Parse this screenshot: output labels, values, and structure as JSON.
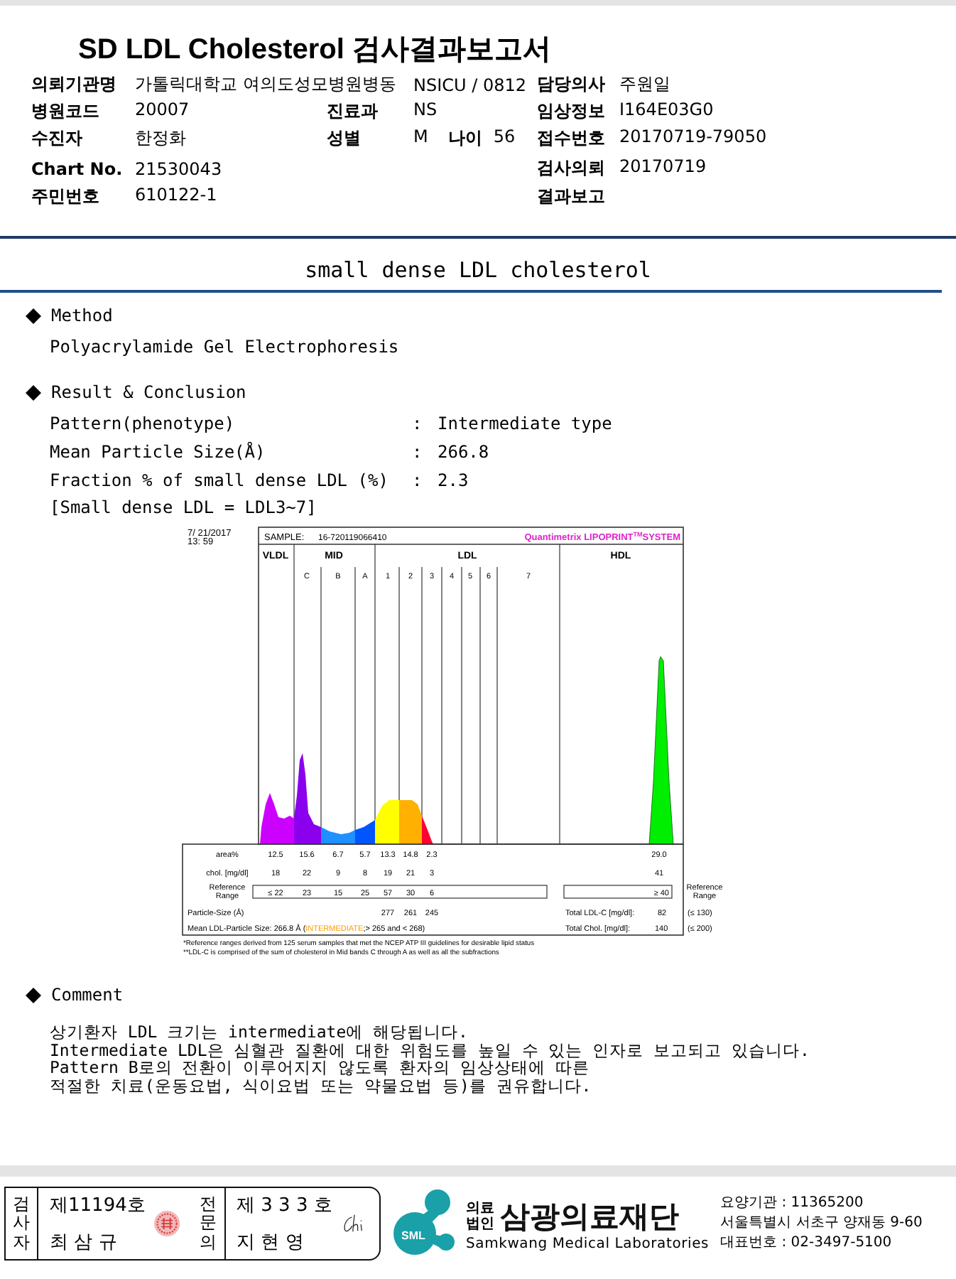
{
  "title": "SD LDL Cholesterol 검사결과보고서",
  "info_rows": [
    {
      "left": {
        "label": "의뢰기관명",
        "value": "가톨릭대학교 여의도성모병원병동"
      },
      "middle": [
        {
          "value": "NSICU / 0812"
        }
      ],
      "right": {
        "label": "담당의사",
        "value": "주원일"
      }
    },
    {
      "left": {
        "label": "병원코드",
        "value": "20007"
      },
      "middle": [
        {
          "label": "진료과",
          "value": "NS"
        }
      ],
      "right": {
        "label": "임상정보",
        "value": "I164E03G0"
      }
    },
    {
      "left": {
        "label": "수진자",
        "value": "한정화"
      },
      "middle": [
        {
          "label": "성별",
          "value": "M"
        },
        {
          "label": "나이",
          "value": "56"
        }
      ],
      "right": {
        "label": "접수번호",
        "value": "20170719-79050"
      }
    },
    {
      "left": {
        "label": "Chart No.",
        "value": "21530043"
      },
      "middle": [],
      "right": {
        "label": "검사의뢰",
        "value": "20170719"
      }
    },
    {
      "left": {
        "label": "주민번호",
        "value": "610122-1"
      },
      "middle": [],
      "right": {
        "label": "결과보고"
      }
    }
  ],
  "section_title": "small dense LDL cholesterol",
  "method": {
    "heading": "Method",
    "text": "Polyacrylamide Gel Electrophoresis"
  },
  "result": {
    "heading": "Result & Conclusion",
    "rows": [
      {
        "label": "Pattern(phenotype)",
        "sep": ":",
        "value": "Intermediate type"
      },
      {
        "label": "Mean Particle Size(Å)",
        "sep": ":",
        "value": "266.8"
      },
      {
        "label": "Fraction % of small dense LDL (%)",
        "sep": ":",
        "value": "2.3"
      }
    ],
    "note": "[Small dense LDL = LDL3~7]"
  },
  "electrophoresis": {
    "date": "7/ 21/2017",
    "time": "13: 59",
    "sample_label": "SAMPLE:",
    "sample_id": "16-720119066410",
    "brand": "Quantimetrix LIPOPRINT",
    "brand_mark": "TM",
    "brand_tail": "SYSTEM",
    "bands": [
      "VLDL",
      "MID",
      "LDL",
      "HDL"
    ],
    "subbands": [
      "C",
      "B",
      "A",
      "1",
      "2",
      "3",
      "4",
      "5",
      "6",
      "7"
    ],
    "rows": [
      {
        "label": "area%",
        "values": [
          "12.5",
          "15.6",
          "6.7",
          "5.7",
          "13.3",
          "14.8",
          "2.3"
        ],
        "hdl": "29.0"
      },
      {
        "label": "chol. [mg/dl]",
        "values": [
          "18",
          "22",
          "9",
          "8",
          "19",
          "21",
          "3"
        ],
        "hdl": "41"
      }
    ],
    "reference": {
      "label_1": "Reference",
      "label_2": "Range",
      "values": [
        "≤ 22",
        "23",
        "15",
        "25",
        "57",
        "30",
        "6"
      ],
      "hdl": "≥ 40",
      "right_label_1": "Reference",
      "right_label_2": "Range"
    },
    "particle": {
      "label": "Particle-Size (Å)",
      "values": [
        "277",
        "261",
        "245"
      ],
      "total_label": "Total LDL-C [mg/dl]:",
      "total_value": "82",
      "limit": "(≤ 130)"
    },
    "mean": {
      "label": "Mean LDL-Particle Size:",
      "value": "266.8 Å",
      "before": "(",
      "category": "INTERMEDIATE",
      "after": ";> 265 and < 268)",
      "total_label": "Total Chol. [mg/dl]:",
      "total_value": "140",
      "limit": "(≤ 200)"
    },
    "footnotes": [
      "*Reference ranges derived from 125 serum samples that met the NCEP ATP III guidelines for desirable lipid status",
      "**LDL-C is comprised of the sum of cholesterol in Mid bands C through A as well as all the subfractions"
    ]
  },
  "comment": {
    "heading": "Comment",
    "lines": [
      "상기환자 LDL 크기는 intermediate에 해당됩니다.",
      "Intermediate LDL은 심혈관 질환에 대한 위험도를 높일 수 있는 인자로 보고되고 있습니다.",
      "Pattern B로의 전환이 이루어지지 않도록 환자의 임상상태에 따른",
      "적절한 치료(운동요법, 식이요법 또는 약물요법 등)를 권유합니다."
    ]
  },
  "footer": {
    "signers": [
      {
        "role": "검사자",
        "number": "제11194호",
        "name": "최 삼 규",
        "kind": "seal"
      },
      {
        "role": "전문의",
        "number": "제 3 3 3 호",
        "name": "지 현 영",
        "kind": "signature"
      }
    ],
    "logo_text": "SML",
    "org_type_1": "의료",
    "org_type_2": "법인",
    "org_name": "삼광의료재단",
    "org_name_en": "Samkwang Medical Laboratories",
    "contact": [
      "요양기관 : 11365200",
      "서울특별시 서초구 양재동 9-60",
      "대표번호 : 02-3497-5100"
    ]
  }
}
